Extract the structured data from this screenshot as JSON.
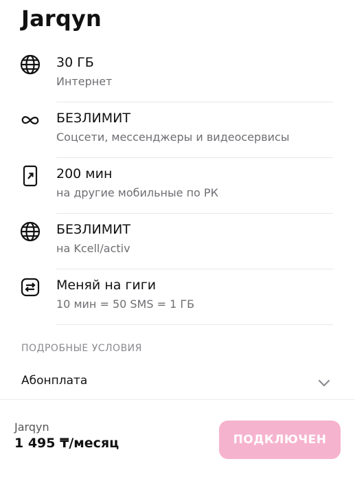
{
  "header": {
    "title": "Jarqyn"
  },
  "features": [
    {
      "icon": "globe-icon",
      "title": "30 ГБ",
      "subtitle": "Интернет"
    },
    {
      "icon": "infinity-icon",
      "title": "БЕЗЛИМИТ",
      "subtitle": "Соцсети, мессенджеры и видеосервисы"
    },
    {
      "icon": "phone-outgoing-icon",
      "title": "200 мин",
      "subtitle": "на другие мобильные по РК"
    },
    {
      "icon": "globe-icon",
      "title": "БЕЗЛИМИТ",
      "subtitle": "на Kcell/activ"
    },
    {
      "icon": "swap-arrows-icon",
      "title": "Меняй на гиги",
      "subtitle": "10 мин = 50 SMS = 1 ГБ"
    }
  ],
  "conditions": {
    "header": "ПОДРОБНЫЕ УСЛОВИЯ",
    "items": [
      {
        "label": "Абонплата",
        "icon": "chevron-down-icon"
      }
    ]
  },
  "footer": {
    "plan_name": "Jarqyn",
    "price": "1 495 ₸/месяц",
    "button_label": "ПОДКЛЮЧЕН",
    "button_color": "#f6b3cd"
  }
}
